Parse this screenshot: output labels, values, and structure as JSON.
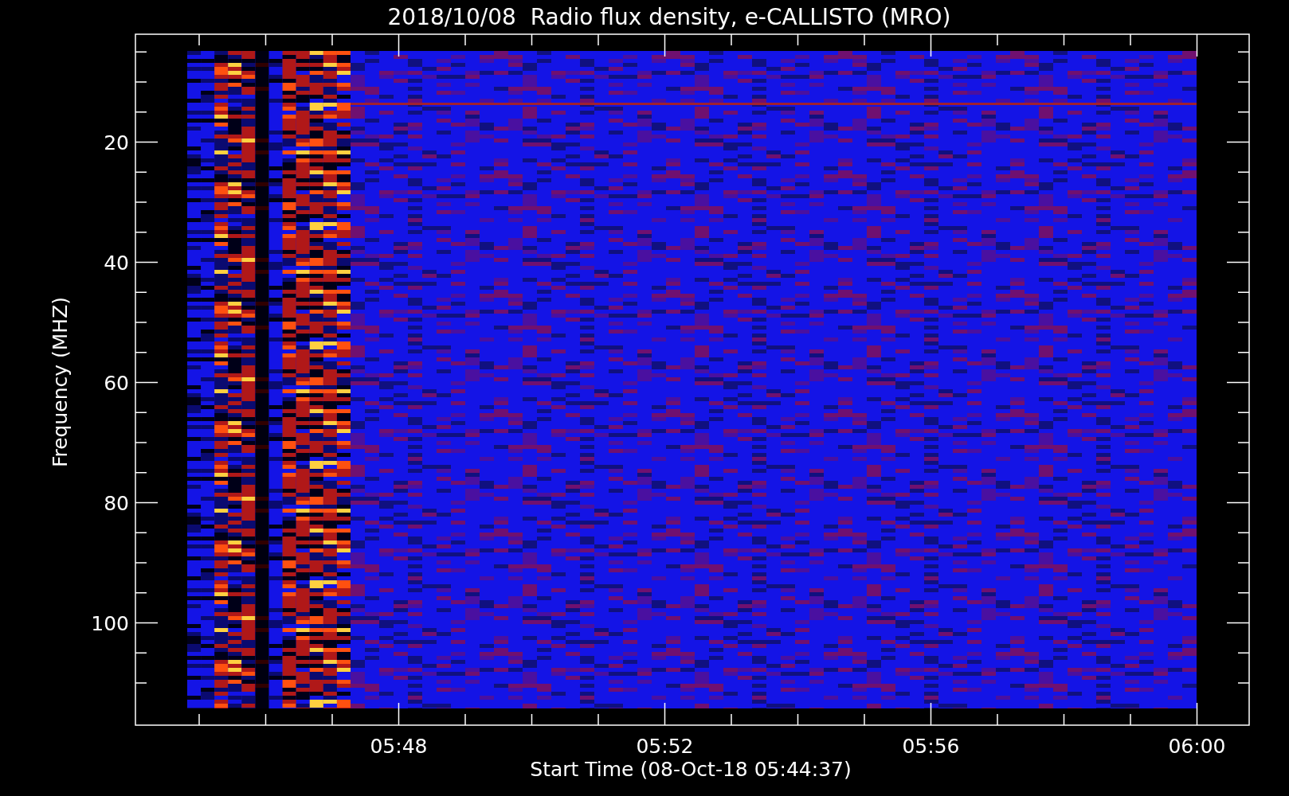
{
  "title": "2018/10/08  Radio flux density, e-CALLISTO (MRO)",
  "y_axis": {
    "label": "Frequency (MHZ)",
    "ticks": [
      "20",
      "40",
      "60",
      "80",
      "100"
    ]
  },
  "x_axis": {
    "label": "Start Time (08-Oct-18 05:44:37)",
    "ticks": [
      "05:48",
      "05:52",
      "05:56",
      "06:00"
    ]
  }
}
